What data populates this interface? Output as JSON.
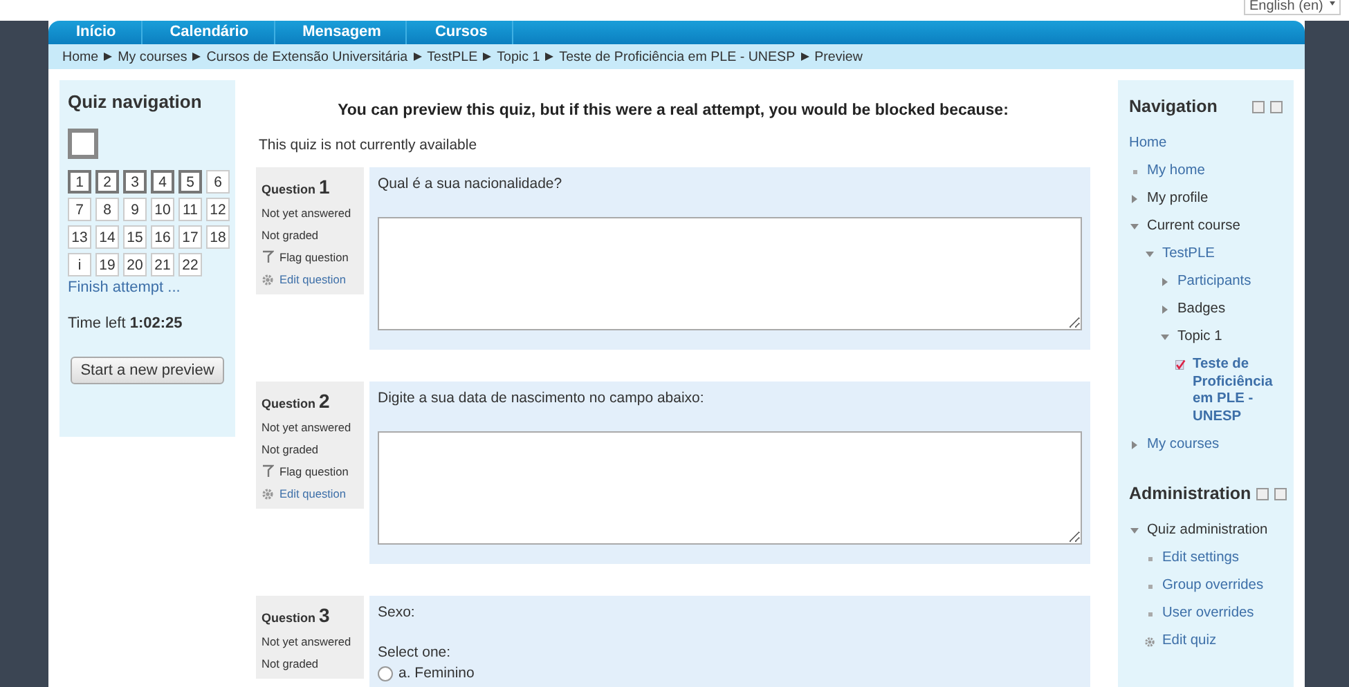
{
  "language_select": {
    "value": "English (en)"
  },
  "menu": [
    {
      "label": "Início"
    },
    {
      "label": "Calendário"
    },
    {
      "label": "Mensagem"
    },
    {
      "label": "Cursos"
    }
  ],
  "breadcrumb": [
    "Home",
    "My courses",
    "Cursos de Extensão Universitária",
    "TestPLE",
    "Topic 1",
    "Teste de Proficiência em PLE - UNESP",
    "Preview"
  ],
  "quiz_navigation": {
    "title": "Quiz navigation",
    "buttons": [
      {
        "label": "1",
        "current": true
      },
      {
        "label": "2",
        "current": true
      },
      {
        "label": "3",
        "current": true
      },
      {
        "label": "4",
        "current": true
      },
      {
        "label": "5",
        "current": true
      },
      {
        "label": "6",
        "current": false
      },
      {
        "label": "7",
        "current": false
      },
      {
        "label": "8",
        "current": false
      },
      {
        "label": "9",
        "current": false
      },
      {
        "label": "10",
        "current": false
      },
      {
        "label": "11",
        "current": false
      },
      {
        "label": "12",
        "current": false
      },
      {
        "label": "13",
        "current": false
      },
      {
        "label": "14",
        "current": false
      },
      {
        "label": "15",
        "current": false
      },
      {
        "label": "16",
        "current": false
      },
      {
        "label": "17",
        "current": false
      },
      {
        "label": "18",
        "current": false
      },
      {
        "label": "i",
        "current": false
      },
      {
        "label": "19",
        "current": false
      },
      {
        "label": "20",
        "current": false
      },
      {
        "label": "21",
        "current": false
      },
      {
        "label": "22",
        "current": false
      }
    ],
    "finish_link": "Finish attempt ...",
    "time_label": "Time left",
    "time_value": "1:02:25",
    "preview_button": "Start a new preview"
  },
  "notice": {
    "heading": "You can preview this quiz, but if this were a real attempt, you would be blocked because:",
    "reason": "This quiz is not currently available"
  },
  "questions": [
    {
      "label": "Question",
      "number": "1",
      "status": "Not yet answered",
      "grade": "Not graded",
      "flag": "Flag question",
      "edit": "Edit question",
      "prompt": "Qual é a sua nacionalidade?",
      "kind": "textarea"
    },
    {
      "label": "Question",
      "number": "2",
      "status": "Not yet answered",
      "grade": "Not graded",
      "flag": "Flag question",
      "edit": "Edit question",
      "prompt": "Digite a sua data de nascimento no campo abaixo:",
      "kind": "textarea"
    },
    {
      "label": "Question",
      "number": "3",
      "status": "Not yet answered",
      "grade": "Not graded",
      "prompt": "Sexo:",
      "kind": "radio",
      "select_label": "Select one:",
      "options": [
        {
          "label": "a. Feminino",
          "selected": false
        }
      ]
    }
  ],
  "navigation": {
    "title": "Navigation",
    "items": [
      {
        "kind": "root",
        "label": "Home",
        "link": true
      },
      {
        "kind": "bullet",
        "label": "My home",
        "link": true
      },
      {
        "kind": "branch",
        "label": "My profile",
        "link": false,
        "expanded": false
      },
      {
        "kind": "branch",
        "label": "Current course",
        "link": false,
        "expanded": true,
        "children": [
          {
            "kind": "branch",
            "label": "TestPLE",
            "link": true,
            "expanded": true,
            "children": [
              {
                "kind": "branch",
                "label": "Participants",
                "link": true,
                "expanded": false
              },
              {
                "kind": "branch",
                "label": "Badges",
                "link": false,
                "expanded": false
              },
              {
                "kind": "branch",
                "label": "Topic 1",
                "link": false,
                "expanded": true,
                "children": [
                  {
                    "kind": "activity",
                    "label": "Teste de Proficiência em PLE - UNESP",
                    "link": true
                  }
                ]
              }
            ]
          }
        ]
      },
      {
        "kind": "branch",
        "label": "My courses",
        "link": true,
        "expanded": false
      }
    ]
  },
  "administration": {
    "title": "Administration",
    "items": [
      {
        "kind": "branch",
        "label": "Quiz administration",
        "link": false,
        "expanded": true,
        "children": [
          {
            "kind": "bullet",
            "label": "Edit settings",
            "link": true
          },
          {
            "kind": "bullet",
            "label": "Group overrides",
            "link": true
          },
          {
            "kind": "bullet",
            "label": "User overrides",
            "link": true
          },
          {
            "kind": "gear",
            "label": "Edit quiz",
            "link": true
          }
        ]
      }
    ]
  }
}
